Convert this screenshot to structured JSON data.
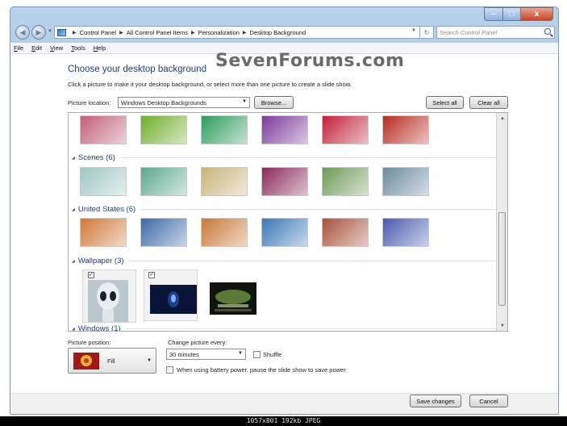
{
  "window": {
    "controls": {
      "minimize": "–",
      "maximize": "□",
      "close": "x"
    }
  },
  "address_bar": {
    "breadcrumbs": [
      "Control Panel",
      "All Control Panel Items",
      "Personalization",
      "Desktop Background"
    ],
    "search_placeholder": "Search Control Panel"
  },
  "menu": [
    "File",
    "Edit",
    "View",
    "Tools",
    "Help"
  ],
  "watermark": "SevenForums.com",
  "main": {
    "title": "Choose your desktop background",
    "description": "Click a picture to make it your desktop background, or select more than one picture to create a slide show.",
    "picture_location_label": "Picture location:",
    "picture_location_value": "Windows Desktop Backgrounds",
    "browse_label": "Browse...",
    "select_all_label": "Select all",
    "clear_all_label": "Clear all"
  },
  "gallery": {
    "top_row": [
      "#c05f7a",
      "#6fae2a",
      "#2e9b5c",
      "#7c3a9a",
      "#c0203a",
      "#b82c20"
    ],
    "groups": [
      {
        "name": "Scenes (6)",
        "thumbs": [
          "#9fc7c4",
          "#5ea88f",
          "#c8b47a",
          "#8a2a5a",
          "#6e9a58",
          "#6a8aa0"
        ]
      },
      {
        "name": "United States (6)",
        "thumbs": [
          "#d1783a",
          "#3c6aa8",
          "#c87838",
          "#3a78b8",
          "#a8503a",
          "#4a5ab0"
        ]
      },
      {
        "name": "Wallpaper (3)",
        "thumbs": [
          "#8aa2b2",
          "#0e1a48",
          "#3b5030"
        ]
      },
      {
        "name": "Windows (1)",
        "thumbs": []
      }
    ]
  },
  "options": {
    "position_label": "Picture position:",
    "position_value": "Fill",
    "change_label": "Change picture every:",
    "change_value": "30 minutes",
    "shuffle_label": "Shuffle",
    "battery_label": "When using battery power, pause the slide show to save power"
  },
  "footer": {
    "save_label": "Save changes",
    "cancel_label": "Cancel"
  },
  "image_caption": "1057x801 192kb JPEG"
}
